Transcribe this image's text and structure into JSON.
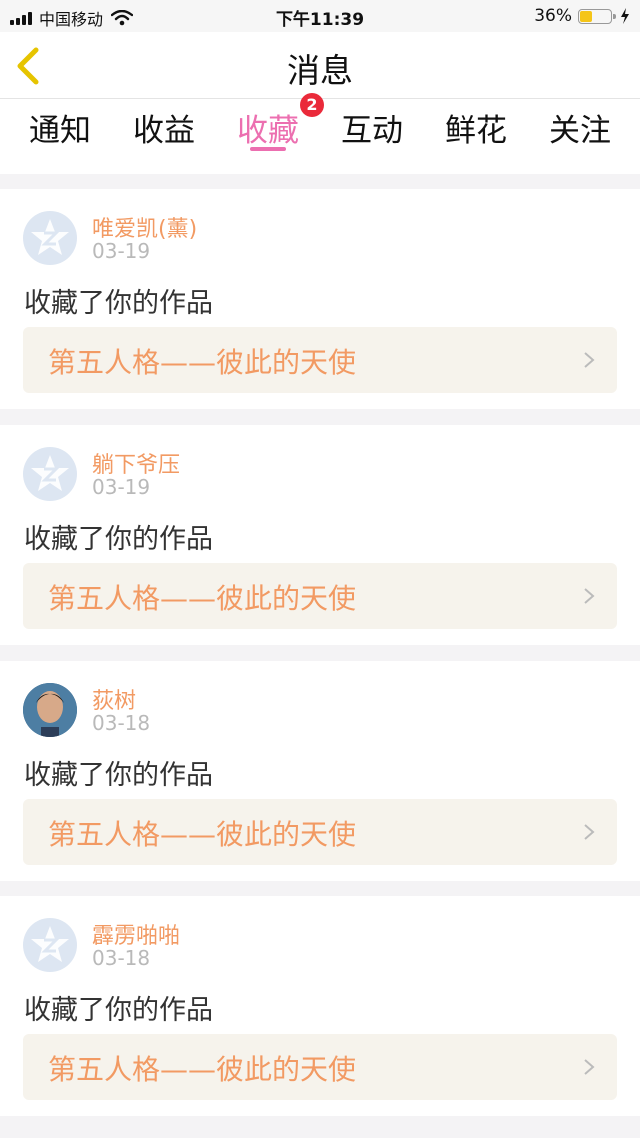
{
  "status_bar": {
    "carrier": "中国移动",
    "time": "下午11:39",
    "battery_percent": "36%",
    "battery_level": 0.36,
    "battery_color": "#f5c518"
  },
  "nav": {
    "title": "消息",
    "back_icon": "chevron-left-icon",
    "back_color": "#e6c400"
  },
  "tabs": [
    {
      "label": "通知",
      "active": false
    },
    {
      "label": "收益",
      "active": false
    },
    {
      "label": "收藏",
      "active": true,
      "badge": "2"
    },
    {
      "label": "互动",
      "active": false
    },
    {
      "label": "鲜花",
      "active": false
    },
    {
      "label": "关注",
      "active": false
    }
  ],
  "colors": {
    "accent": "#ec6fb0",
    "name": "#f29a63",
    "badge": "#ea2a3a",
    "work_bg": "#f6f3ec"
  },
  "notifications": [
    {
      "user": "唯爱凯(薰)",
      "date": "03-19",
      "action": "收藏了你的作品",
      "work": "第五人格——彼此的天使",
      "avatar": "default-avatar-icon"
    },
    {
      "user": "躺下爷压",
      "date": "03-19",
      "action": "收藏了你的作品",
      "work": "第五人格——彼此的天使",
      "avatar": "default-avatar-icon"
    },
    {
      "user": "荻树",
      "date": "03-18",
      "action": "收藏了你的作品",
      "work": "第五人格——彼此的天使",
      "avatar": "user-photo"
    },
    {
      "user": "霹雳啪啪",
      "date": "03-18",
      "action": "收藏了你的作品",
      "work": "第五人格——彼此的天使",
      "avatar": "default-avatar-icon"
    }
  ]
}
